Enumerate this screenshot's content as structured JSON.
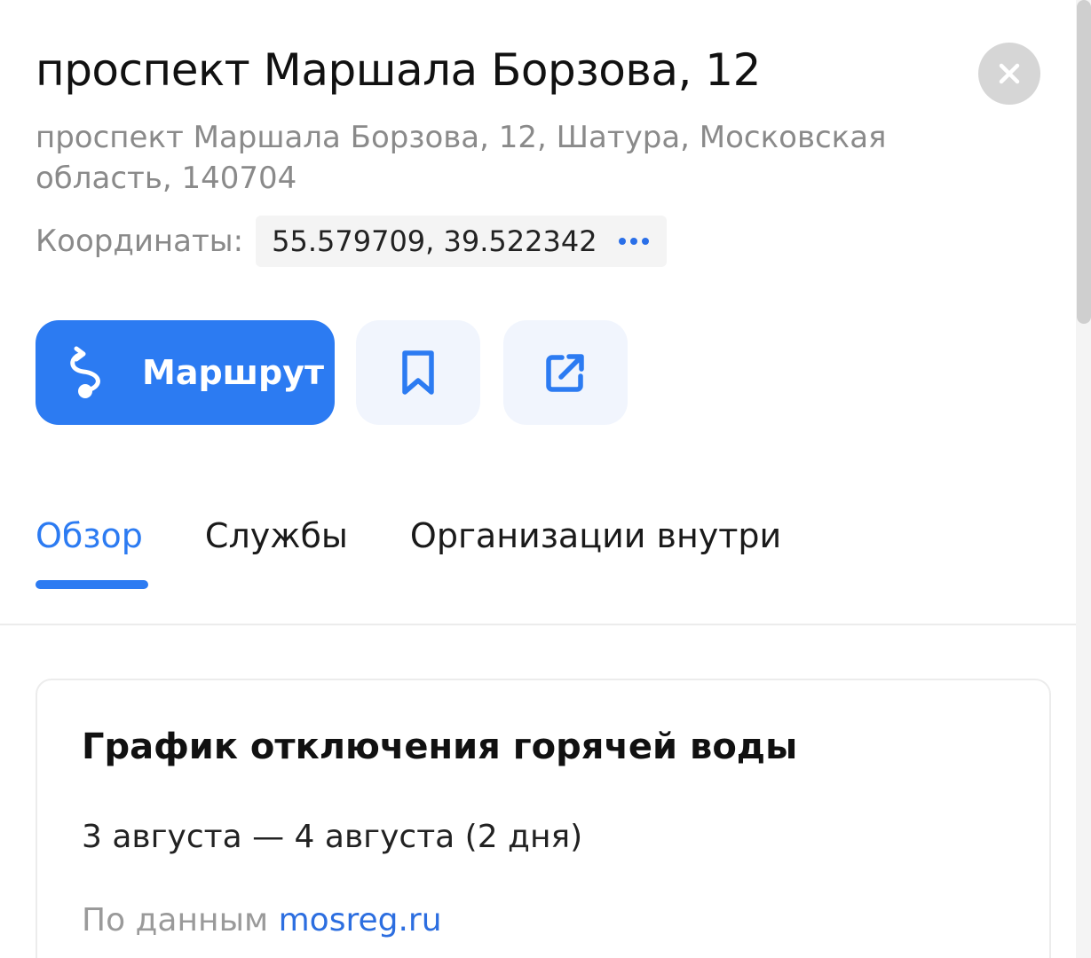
{
  "header": {
    "title": "проспект Маршала Борзова, 12",
    "address": "проспект Маршала Борзова, 12, Шатура, Московская область, 140704",
    "coordinates_label": "Координаты:",
    "coordinates_value": "55.579709, 39.522342"
  },
  "actions": {
    "route_label": "Маршрут",
    "bookmark_icon": "bookmark-icon",
    "share_icon": "share-icon"
  },
  "tabs": [
    {
      "label": "Обзор",
      "active": true
    },
    {
      "label": "Службы",
      "active": false
    },
    {
      "label": "Организации внутри",
      "active": false
    }
  ],
  "card": {
    "title": "График отключения горячей воды",
    "dates": "3 августа — 4 августа (2 дня)",
    "source_prefix": "По данным",
    "source_link": "mosreg.ru"
  },
  "colors": {
    "accent": "#2c7bf2",
    "secondary_text": "#8a8a8a",
    "icon_button_bg": "#f1f5fd"
  }
}
